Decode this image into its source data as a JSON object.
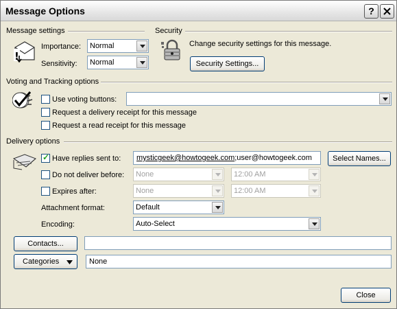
{
  "window": {
    "title": "Message Options",
    "help_label": "?",
    "close_label": "X"
  },
  "message_settings": {
    "heading": "Message settings",
    "importance_label": "Importance:",
    "importance_value": "Normal",
    "sensitivity_label": "Sensitivity:",
    "sensitivity_value": "Normal"
  },
  "security": {
    "heading": "Security",
    "description": "Change security settings for this message.",
    "button_label": "Security Settings..."
  },
  "voting": {
    "heading": "Voting and Tracking options",
    "use_voting_label": "Use voting buttons:",
    "use_voting_value": "",
    "delivery_receipt_label": "Request a delivery receipt for this message",
    "read_receipt_label": "Request a read receipt for this message"
  },
  "delivery": {
    "heading": "Delivery options",
    "replies_label": "Have replies sent to:",
    "replies_value_1": "mysticgeek@howtogeek.com",
    "replies_separator": ";",
    "replies_value_2": "user@howtogeek.com",
    "select_names_label": "Select Names...",
    "do_not_deliver_label": "Do not deliver before:",
    "do_not_deliver_date": "None",
    "do_not_deliver_time": "12:00 AM",
    "expires_label": "Expires after:",
    "expires_date": "None",
    "expires_time": "12:00 AM",
    "attachment_label": "Attachment format:",
    "attachment_value": "Default",
    "encoding_label": "Encoding:",
    "encoding_value": "Auto-Select"
  },
  "contacts": {
    "button_label": "Contacts...",
    "value": ""
  },
  "categories": {
    "button_label": "Categories",
    "value": "None"
  },
  "footer": {
    "close_label": "Close"
  },
  "checkbox_states": {
    "use_voting": false,
    "delivery_receipt": false,
    "read_receipt": false,
    "have_replies": true,
    "do_not_deliver": false,
    "expires": false
  }
}
